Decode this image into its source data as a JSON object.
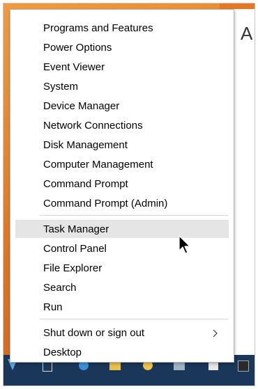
{
  "menu": {
    "groups": [
      {
        "items": [
          {
            "label": "Programs and Features"
          },
          {
            "label": "Power Options"
          },
          {
            "label": "Event Viewer"
          },
          {
            "label": "System"
          },
          {
            "label": "Device Manager"
          },
          {
            "label": "Network Connections"
          },
          {
            "label": "Disk Management"
          },
          {
            "label": "Computer Management"
          },
          {
            "label": "Command Prompt"
          },
          {
            "label": "Command Prompt (Admin)"
          }
        ]
      },
      {
        "items": [
          {
            "label": "Task Manager",
            "highlighted": true
          },
          {
            "label": "Control Panel"
          },
          {
            "label": "File Explorer"
          },
          {
            "label": "Search"
          },
          {
            "label": "Run"
          }
        ]
      },
      {
        "items": [
          {
            "label": "Shut down or sign out",
            "has_submenu": true,
            "submenu_icon": "chevron-right-icon"
          },
          {
            "label": "Desktop"
          }
        ]
      }
    ]
  },
  "background": {
    "window_letter": "A",
    "accent_color": "#e87722",
    "taskbar_color": "#1a3658",
    "highlight_color": "#e5e5e5"
  },
  "pointer": {
    "icon": "mouse-pointer-icon"
  }
}
